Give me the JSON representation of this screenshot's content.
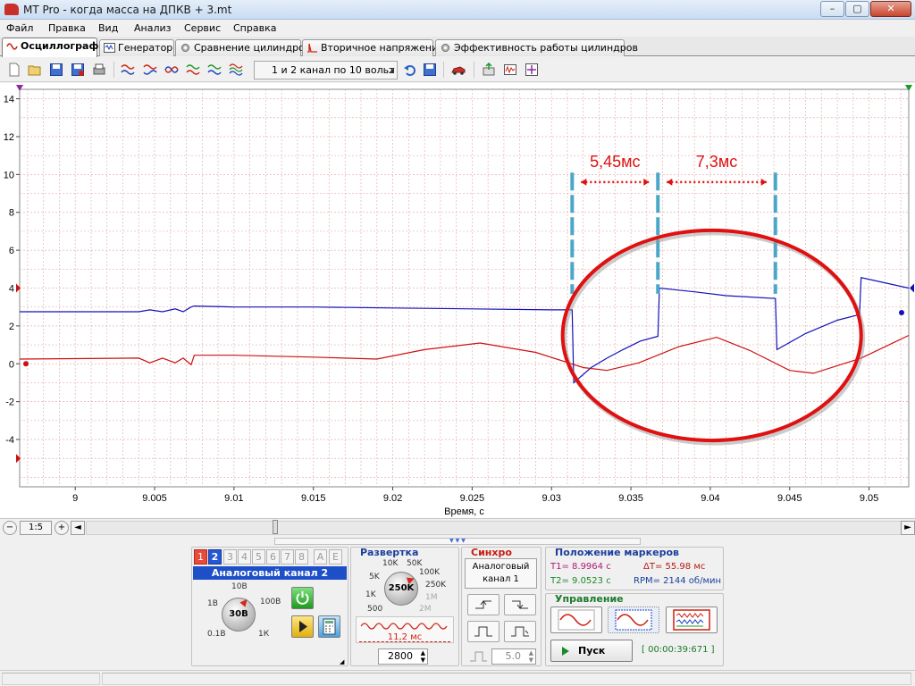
{
  "window": {
    "title": "MT Pro - когда масса на ДПКВ + 3.mt",
    "min_label": "–",
    "max_label": "▢",
    "close_label": "✕"
  },
  "menu": [
    "Файл",
    "Правка",
    "Вид",
    "Анализ",
    "Сервис",
    "Справка"
  ],
  "tabs": [
    {
      "label": "Осциллограф",
      "active": true,
      "icon": "wave-icon"
    },
    {
      "label": "Генератор",
      "active": false,
      "icon": "generator-icon"
    },
    {
      "label": "Сравнение цилиндров",
      "active": false,
      "icon": "gear-icon"
    },
    {
      "label": "Вторичное напряжение",
      "active": false,
      "icon": "ignition-icon"
    },
    {
      "label": "Эффективность работы цилиндров",
      "active": false,
      "icon": "gear-icon"
    }
  ],
  "toolbar": {
    "preset": "1 и 2 канал по 10 вольт",
    "icons": [
      "new-file-icon",
      "open-folder-icon",
      "save-icon",
      "save-as-icon",
      "print-icon",
      "waves-icon",
      "waves-icon",
      "waves-icon",
      "waves-icon",
      "waves-icon",
      "undo-icon",
      "save-small-icon",
      "car-icon",
      "export-icon",
      "spectrum-icon",
      "fit-icon"
    ]
  },
  "scope": {
    "y_ticks": [
      "14",
      "12",
      "10",
      "8",
      "6",
      "4",
      "2",
      "0",
      "-2",
      "-4"
    ],
    "x_ticks": [
      "9",
      "9.005",
      "9.01",
      "9.015",
      "9.02",
      "9.025",
      "9.03",
      "9.035",
      "9.04",
      "9.045",
      "9.05"
    ],
    "xlabel": "Время, с",
    "colors": {
      "ch1": "#cc1111",
      "ch2": "#1111bb",
      "annotation": "#e01010",
      "marker": "#4aa7c9",
      "grid": "#e7b0b0"
    },
    "annotations": [
      {
        "label": "5,45мс"
      },
      {
        "label": "7,3мс"
      }
    ]
  },
  "chart_data": {
    "type": "line",
    "xlabel": "Время, с",
    "ylabel": "",
    "xlim": [
      8.9965,
      9.0525
    ],
    "ylim": [
      -6.5,
      14.5
    ],
    "series": [
      {
        "points": [
          [
            8.9965,
            2.75
          ],
          [
            9.0,
            2.75
          ],
          [
            9.004,
            2.75
          ],
          [
            9.0047,
            2.85
          ],
          [
            9.0055,
            2.75
          ],
          [
            9.0063,
            2.9
          ],
          [
            9.0068,
            2.75
          ],
          [
            9.0073,
            3.0
          ],
          [
            9.0075,
            3.05
          ],
          [
            9.01,
            3.0
          ],
          [
            9.015,
            3.0
          ],
          [
            9.02,
            2.95
          ],
          [
            9.025,
            2.9
          ],
          [
            9.03,
            2.85
          ],
          [
            9.0313,
            2.85
          ],
          [
            9.0314,
            -1.0
          ],
          [
            9.0325,
            -0.2
          ],
          [
            9.0335,
            0.3
          ],
          [
            9.0345,
            0.75
          ],
          [
            9.0356,
            1.2
          ],
          [
            9.0367,
            1.45
          ],
          [
            9.0368,
            4.0
          ],
          [
            9.039,
            3.8
          ],
          [
            9.041,
            3.6
          ],
          [
            9.0441,
            3.45
          ],
          [
            9.0442,
            0.75
          ],
          [
            9.046,
            1.6
          ],
          [
            9.048,
            2.3
          ],
          [
            9.0494,
            2.6
          ],
          [
            9.0495,
            4.55
          ],
          [
            9.0525,
            4.0
          ]
        ]
      },
      {
        "points": [
          [
            8.9965,
            0.25
          ],
          [
            9.004,
            0.3
          ],
          [
            9.0047,
            0.05
          ],
          [
            9.0055,
            0.3
          ],
          [
            9.0063,
            0.05
          ],
          [
            9.0068,
            0.3
          ],
          [
            9.0073,
            -0.05
          ],
          [
            9.0075,
            0.45
          ],
          [
            9.01,
            0.45
          ],
          [
            9.015,
            0.35
          ],
          [
            9.019,
            0.25
          ],
          [
            9.022,
            0.75
          ],
          [
            9.0255,
            1.1
          ],
          [
            9.029,
            0.6
          ],
          [
            9.032,
            -0.2
          ],
          [
            9.0335,
            -0.35
          ],
          [
            9.0355,
            0.05
          ],
          [
            9.038,
            0.9
          ],
          [
            9.0404,
            1.4
          ],
          [
            9.0425,
            0.7
          ],
          [
            9.045,
            -0.35
          ],
          [
            9.0465,
            -0.5
          ],
          [
            9.0495,
            0.3
          ],
          [
            9.0525,
            1.5
          ]
        ]
      }
    ]
  },
  "zoom": {
    "zoom_out": "−",
    "ratio": "1:5",
    "zoom_in": "+",
    "left": "◄",
    "right": "►"
  },
  "channel_panel": {
    "tabs": [
      "1",
      "2",
      "3",
      "4",
      "5",
      "6",
      "7",
      "8",
      "A",
      "E"
    ],
    "title": "Аналоговый канал 2",
    "knob_value": "30В",
    "knob_labels": [
      "10В",
      "1В",
      "100В",
      "0.1В",
      "1К"
    ]
  },
  "sweep_panel": {
    "title": "Развертка",
    "knob_value": "250K",
    "knob_labels_active": [
      "10K",
      "50K",
      "5K",
      "100K",
      "1K",
      "250K",
      "500"
    ],
    "knob_labels_dim": [
      "1M",
      "2M"
    ],
    "duration": "11,2 мс",
    "points": "2800"
  },
  "sync_panel": {
    "title": "Синхро",
    "source": "Аналоговый канал 1",
    "level": "5.0"
  },
  "markers_panel": {
    "title": "Положение маркеров",
    "t1": "T1= 8.9964 с",
    "t2": "T2= 9.0523 с",
    "dt": "ΔT= 55.98 мс",
    "rpm": "RPM= 2144 об/мин"
  },
  "control_panel": {
    "title": "Управление",
    "start": "Пуск",
    "timer": "[ 00:00:39:671 ]"
  }
}
